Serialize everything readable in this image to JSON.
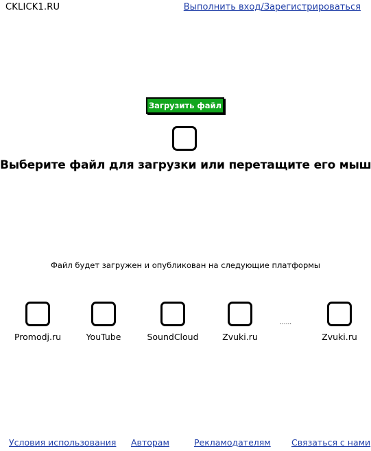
{
  "header": {
    "logo": "CKLICK1.RU",
    "login_link": "Выполнить вход/Зарегистрироваться"
  },
  "upload": {
    "button_label": "Загрузить файл",
    "headline": "Выберите файл для загрузки или перетащите его мышью"
  },
  "platforms": {
    "note": "Файл будет загружен и опубликован на следующие платформы",
    "items": [
      {
        "label": "Promodj.ru"
      },
      {
        "label": "YouTube"
      },
      {
        "label": "SoundCloud"
      },
      {
        "label": "Zvuki.ru"
      },
      {
        "label": "Zvuki.ru"
      }
    ],
    "more": "......"
  },
  "footer": {
    "links": [
      {
        "label": "Условия использования"
      },
      {
        "label": "Авторам"
      },
      {
        "label": "Рекламодателям"
      },
      {
        "label": "Связаться с нами"
      }
    ]
  }
}
